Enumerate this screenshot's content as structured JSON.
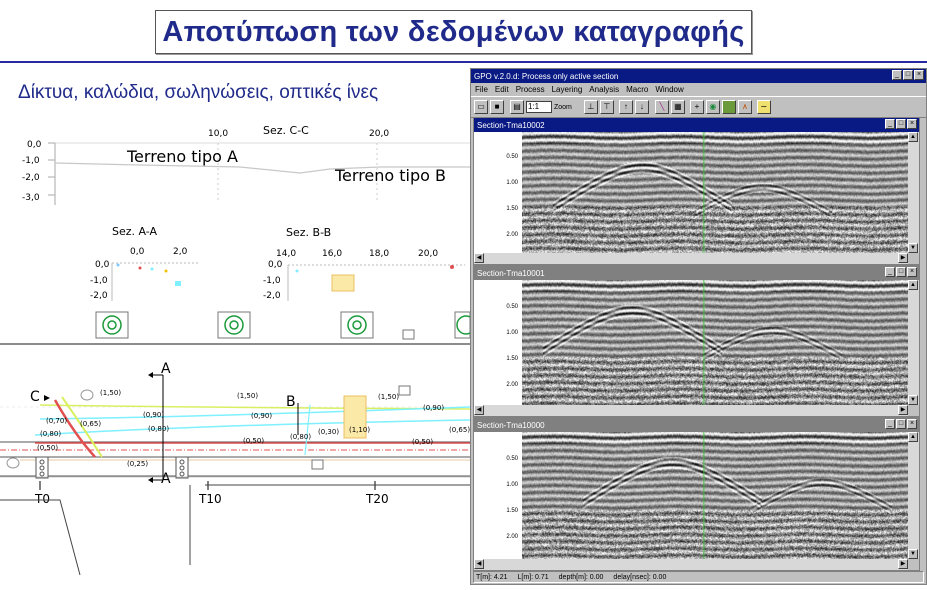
{
  "slide": {
    "title": "Αποτύπωση των δεδομένων καταγραφής",
    "subtitle": "Δίκτυα, καλώδια, σωληνώσεις, οπτικές ίνες"
  },
  "drawing": {
    "section_cc": {
      "title": "Sez. C-C",
      "x_ticks": [
        "10,0",
        "20,0"
      ],
      "y_ticks": [
        "0,0",
        "-1,0",
        "-2,0",
        "-3,0"
      ],
      "labels": [
        "Terreno tipo A",
        "Terreno tipo B"
      ]
    },
    "section_aa": {
      "title": "Sez. A-A",
      "x_ticks": [
        "0,0",
        "2,0"
      ],
      "y_ticks": [
        "0,0",
        "-1,0",
        "-2,0"
      ]
    },
    "section_bb": {
      "title": "Sez. B-B",
      "x_ticks": [
        "14,0",
        "16,0",
        "18,0",
        "20,0"
      ],
      "y_ticks": [
        "0,0",
        "-1,0",
        "-2,0"
      ]
    },
    "plan": {
      "markers": [
        "A",
        "A",
        "B",
        "C"
      ],
      "stations": [
        "T0",
        "T10",
        "T20"
      ],
      "depths": [
        "(1,50)",
        "(1,50)",
        "(1,50)",
        "(0,90)",
        "(0,90)",
        "(0,90)",
        "(0,80)",
        "(0,70)",
        "(0,65)",
        "(0,65)",
        "(0,80)",
        "(0,50)",
        "(0,50)",
        "(0,50)",
        "(0,25)",
        "(0,80)",
        "(0,30)",
        "(1,10)"
      ]
    }
  },
  "app": {
    "window_title": "GPO v.2.0.d: Process only active section",
    "menu": [
      "File",
      "Edit",
      "Process",
      "Layering",
      "Analysis",
      "Macro",
      "Window"
    ],
    "zoom_label": "Zoom",
    "zoom_value": "1:1",
    "sections": [
      {
        "title": "Section-Tma10002",
        "active": true,
        "ticks": [
          "0.50",
          "1.00",
          "1.50",
          "2.00"
        ]
      },
      {
        "title": "Section-Tma10001",
        "active": false,
        "ticks": [
          "0.50",
          "1.00",
          "1.50",
          "2.00"
        ]
      },
      {
        "title": "Section-Tma10000",
        "active": false,
        "ticks": [
          "0.50",
          "1.00",
          "1.50",
          "2.00"
        ]
      }
    ],
    "status": [
      "T[m]: 4.21",
      "L[m]: 0.71",
      "depth[m]: 0.00",
      "delay[nsec]: 0.00"
    ],
    "colors": {
      "titlebar_active": "#0a1a84",
      "titlebar_inactive": "#808080",
      "slide_title": "#1f2a8a"
    }
  }
}
